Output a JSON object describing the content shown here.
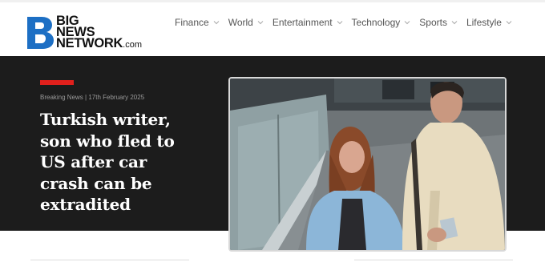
{
  "brand": {
    "line1": "BIG",
    "line2": "NEWS",
    "line3": "NETWORK",
    "suffix": ".com",
    "accent_color": "#1d6fc4"
  },
  "nav": {
    "items": [
      {
        "label": "Finance",
        "icon": "chevron-down-icon"
      },
      {
        "label": "World",
        "icon": "chevron-down-icon"
      },
      {
        "label": "Entertainment",
        "icon": "chevron-down-icon"
      },
      {
        "label": "Technology",
        "icon": "chevron-down-icon"
      },
      {
        "label": "Sports",
        "icon": "chevron-down-icon"
      },
      {
        "label": "Lifestyle",
        "icon": "chevron-down-icon"
      }
    ]
  },
  "hero": {
    "meta": "Breaking News | 17th February 2025",
    "headline_lines": [
      "Turkish writer,",
      "son who fled to",
      "US after car",
      "crash can be",
      "extradited"
    ],
    "accent_color": "#e0201c",
    "background": "#1c1c1c"
  }
}
